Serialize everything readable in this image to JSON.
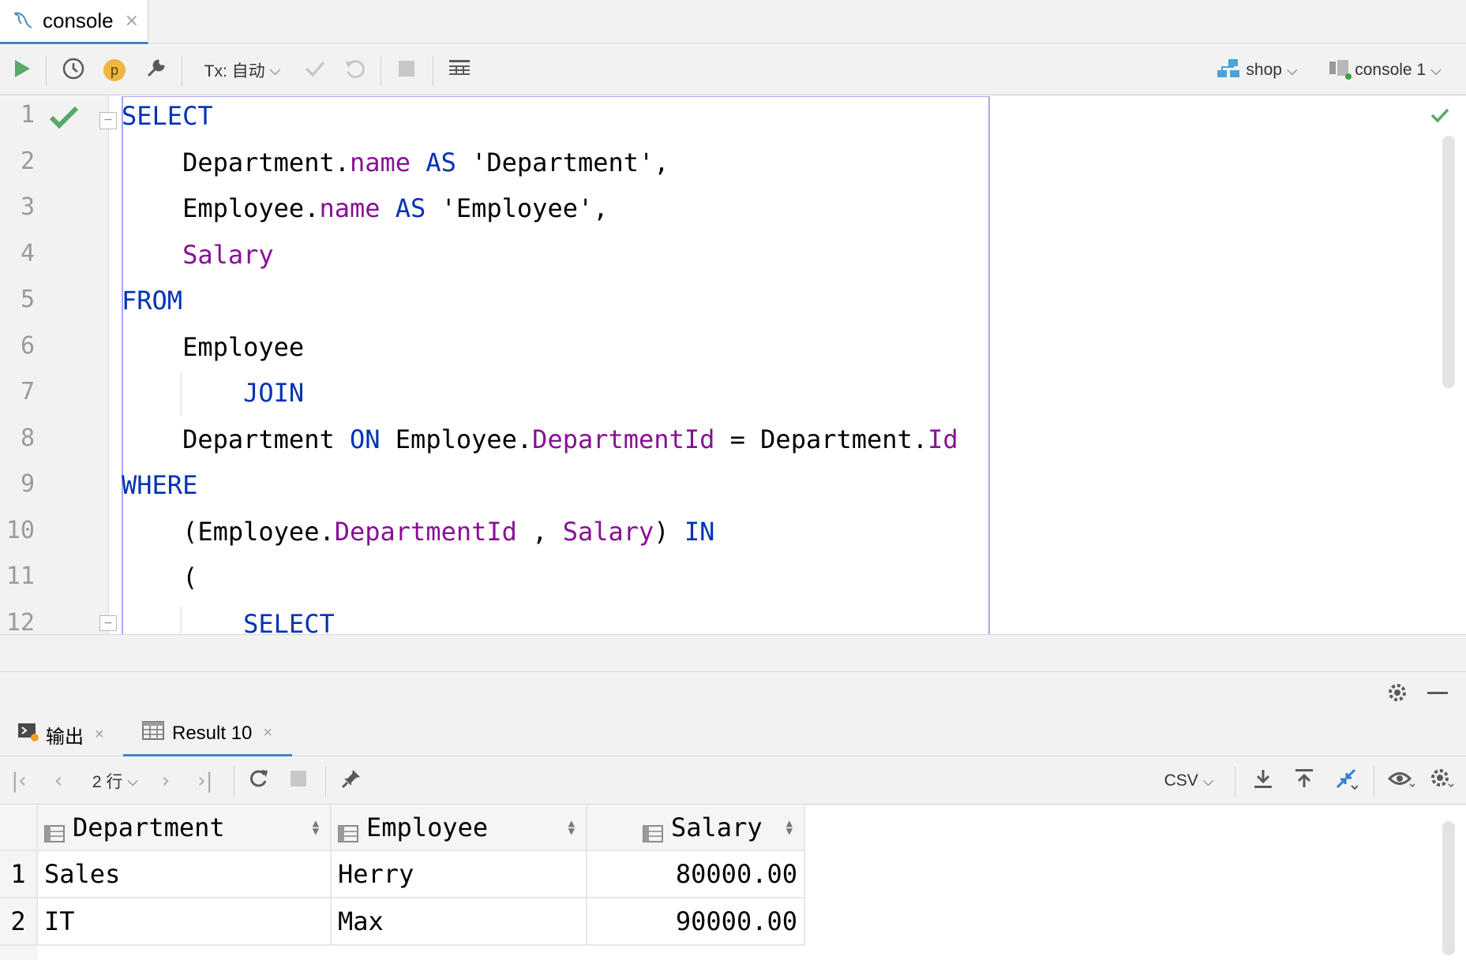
{
  "tab": {
    "label": "console",
    "close": "×"
  },
  "toolbar": {
    "profile_badge": "p",
    "tx_mode": "Tx: 自动",
    "schema": "shop",
    "session": "console 1"
  },
  "editor": {
    "line_numbers": [
      "1",
      "2",
      "3",
      "4",
      "5",
      "6",
      "7",
      "8",
      "9",
      "10",
      "11",
      "12"
    ],
    "lines": [
      [
        {
          "t": "SELECT",
          "c": "kw"
        }
      ],
      [
        {
          "t": "    Department.",
          "c": ""
        },
        {
          "t": "name",
          "c": "fld"
        },
        {
          "t": " AS",
          "c": "kw"
        },
        {
          "t": " 'Department',",
          "c": ""
        }
      ],
      [
        {
          "t": "    Employee.",
          "c": ""
        },
        {
          "t": "name",
          "c": "fld"
        },
        {
          "t": " AS",
          "c": "kw"
        },
        {
          "t": " 'Employee',",
          "c": ""
        }
      ],
      [
        {
          "t": "    ",
          "c": ""
        },
        {
          "t": "Salary",
          "c": "fld"
        }
      ],
      [
        {
          "t": "FROM",
          "c": "kw"
        }
      ],
      [
        {
          "t": "    Employee",
          "c": ""
        }
      ],
      [
        {
          "t": "        ",
          "c": ""
        },
        {
          "t": "JOIN",
          "c": "kw"
        }
      ],
      [
        {
          "t": "    Department ",
          "c": ""
        },
        {
          "t": "ON",
          "c": "kw"
        },
        {
          "t": " Employee.",
          "c": ""
        },
        {
          "t": "DepartmentId",
          "c": "fld"
        },
        {
          "t": " = Department.",
          "c": ""
        },
        {
          "t": "Id",
          "c": "fld"
        }
      ],
      [
        {
          "t": "WHERE",
          "c": "kw"
        }
      ],
      [
        {
          "t": "    (Employee.",
          "c": ""
        },
        {
          "t": "DepartmentId",
          "c": "fld"
        },
        {
          "t": " , ",
          "c": ""
        },
        {
          "t": "Salary",
          "c": "fld"
        },
        {
          "t": ") ",
          "c": ""
        },
        {
          "t": "IN",
          "c": "kw"
        }
      ],
      [
        {
          "t": "    (",
          "c": ""
        }
      ],
      [
        {
          "t": "        ",
          "c": ""
        },
        {
          "t": "SELECT",
          "c": "kw"
        }
      ]
    ]
  },
  "results": {
    "tabs": [
      {
        "label": "输出",
        "close": "×"
      },
      {
        "label": "Result 10",
        "close": "×"
      }
    ],
    "row_count": "2 行",
    "export_format": "CSV",
    "columns": [
      "Department",
      "Employee",
      "Salary"
    ],
    "rows": [
      {
        "num": "1",
        "cells": [
          "Sales",
          "Herry",
          "80000.00"
        ]
      },
      {
        "num": "2",
        "cells": [
          "IT",
          "Max",
          "90000.00"
        ]
      }
    ]
  },
  "colors": {
    "keyword": "#0033b3",
    "field": "#871094",
    "accent": "#4083c9",
    "run_green": "#59a869"
  }
}
